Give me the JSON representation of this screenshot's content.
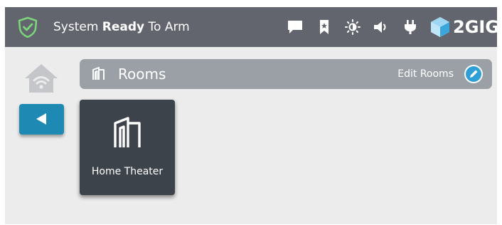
{
  "status": {
    "prefix": "System ",
    "state": "Ready",
    "suffix": " To Arm"
  },
  "toolbar": {
    "icons": [
      "message-icon",
      "bookmark-icon",
      "brightness-icon",
      "volume-icon",
      "power-plug-icon"
    ]
  },
  "brand": {
    "logo_text": "2GIG"
  },
  "rooms": {
    "title": "Rooms",
    "edit_label": "Edit Rooms",
    "items": [
      {
        "label": "Home Theater",
        "icon": "room-door-icon"
      }
    ]
  },
  "colors": {
    "topbar": "#62656d",
    "status_ok": "#7bd37b",
    "accent": "#1e8ab4",
    "tile": "#3d434b",
    "rooms_bar": "#9aa0a6"
  }
}
